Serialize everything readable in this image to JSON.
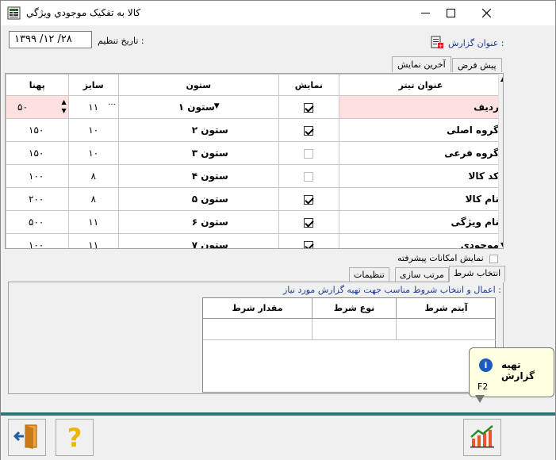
{
  "window": {
    "title": "كالا به تفكيک موجودي ويژگي",
    "minimize_icon": "minimize-icon",
    "maximize_icon": "maximize-icon",
    "close_icon": "close-icon"
  },
  "header": {
    "date_label": "تاریخ تنظیم :",
    "date_value": "۱۳۹۹ /۱۲ /۲۸",
    "report_title_label": "عنوان گزارش :"
  },
  "top_tabs": {
    "default": "پیش فرض",
    "last_display": "آخرین نمایش"
  },
  "grid": {
    "columns": [
      "عنوان تیتر",
      "نمایش",
      "ستون",
      "سایز",
      "پهنا"
    ],
    "rows": [
      {
        "title": "ردیف",
        "show": true,
        "column": "ستون ۱",
        "size": "۱۱",
        "width": "۵۰",
        "selected": true
      },
      {
        "title": "گروه اصلی",
        "show": true,
        "column": "ستون ۲",
        "size": "۱۰",
        "width": "۱۵۰"
      },
      {
        "title": "گروه فرعی",
        "show": false,
        "column": "ستون ۳",
        "size": "۱۰",
        "width": "۱۵۰"
      },
      {
        "title": "کد کالا",
        "show": false,
        "column": "ستون ۴",
        "size": "۸",
        "width": "۱۰۰"
      },
      {
        "title": "نام کالا",
        "show": true,
        "column": "ستون ۵",
        "size": "۸",
        "width": "۲۰۰"
      },
      {
        "title": "نام ویژگی",
        "show": true,
        "column": "ستون ۶",
        "size": "۱۱",
        "width": "۵۰۰"
      },
      {
        "title": "موجودی",
        "show": true,
        "column": "ستون ۷",
        "size": "۱۱",
        "width": "۱۰۰"
      }
    ]
  },
  "advanced": {
    "label": "نمایش امکانات پیشرفته",
    "checked": false
  },
  "lower_tabs": {
    "condition": "انتخاب شرط",
    "sorting": "مرتب سازی",
    "settings": "تنظیمات"
  },
  "conditions": {
    "hint": "اعمال و انتخاب شروط مناسب جهت تهیه گزارش  مورد نیاز :",
    "columns": [
      "آیتم شرط",
      "نوع شرط",
      "مقدار شرط"
    ]
  },
  "tooltip": {
    "title": "تهیه گزارش",
    "shortcut": "F2"
  },
  "buttons": {
    "exit_icon": "exit-icon",
    "help_icon": "help-icon",
    "report_icon": "report-chart-icon"
  },
  "colors": {
    "accent_bar": "#2e7474",
    "selected_row": "#ffe0e0",
    "label_blue": "#1f3a93",
    "tooltip_bg": "#ffffe1"
  }
}
